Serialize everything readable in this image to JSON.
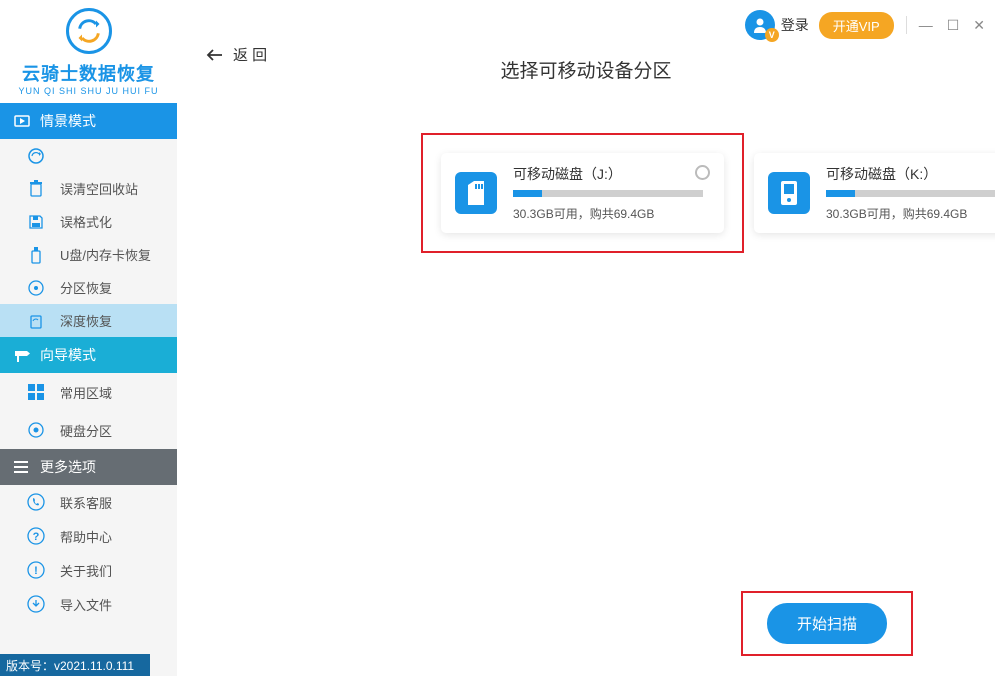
{
  "logo": {
    "title": "云骑士数据恢复",
    "subtitle": "YUN QI SHI SHU JU HUI FU"
  },
  "sections": {
    "scene": "情景模式",
    "guide": "向导模式",
    "more": "更多选项"
  },
  "sidebar": {
    "scene_items": [
      {
        "label": "",
        "icon": "refresh-icon"
      },
      {
        "label": "误清空回收站",
        "icon": "recycle-bin-icon"
      },
      {
        "label": "误格式化",
        "icon": "save-disk-icon"
      },
      {
        "label": "U盘/内存卡恢复",
        "icon": "usb-icon"
      },
      {
        "label": "分区恢复",
        "icon": "partition-icon"
      },
      {
        "label": "深度恢复",
        "icon": "deep-scan-icon"
      }
    ],
    "guide_items": [
      {
        "label": "常用区域",
        "icon": "windows-icon"
      },
      {
        "label": "硬盘分区",
        "icon": "harddisk-icon"
      }
    ],
    "more_items": [
      {
        "label": "联系客服",
        "icon": "phone-icon"
      },
      {
        "label": "帮助中心",
        "icon": "help-icon"
      },
      {
        "label": "关于我们",
        "icon": "info-icon"
      },
      {
        "label": "导入文件",
        "icon": "import-icon"
      }
    ]
  },
  "version": "版本号：v2021.11.0.111",
  "topbar": {
    "login": "登录",
    "vip_badge": "V",
    "vip_button": "开通VIP"
  },
  "back_label": "返    回",
  "page_title": "选择可移动设备分区",
  "partitions": [
    {
      "title": "可移动磁盘（J:）",
      "info": "30.3GB可用，购共69.4GB",
      "fill_percent": 15,
      "icon": "sd-card-icon",
      "highlighted": true
    },
    {
      "title": "可移动磁盘（K:）",
      "info": "30.3GB可用，购共69.4GB",
      "fill_percent": 15,
      "icon": "hdd-icon",
      "highlighted": false
    }
  ],
  "scan_button": "开始扫描"
}
